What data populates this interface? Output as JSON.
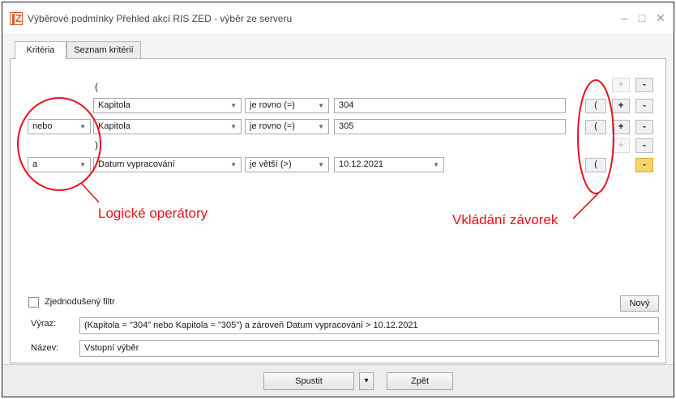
{
  "window": {
    "title": "Výběrové podmínky Přehled akcí RIS ZED - výběr ze serveru",
    "minimize_glyph": "–",
    "maximize_glyph": "□",
    "close_glyph": "✕",
    "icon": "app-logo-icon"
  },
  "tabs": [
    {
      "label": "Kritéria",
      "active": true
    },
    {
      "label": "Seznam kritérií",
      "active": false
    }
  ],
  "criteria": {
    "open_paren": "(",
    "close_paren": ")",
    "rows": [
      {
        "operator": "",
        "field": "Kapitola",
        "condition": "je rovno (=)",
        "value": "304"
      },
      {
        "operator": "nebo",
        "field": "Kapitola",
        "condition": "je rovno (=)",
        "value": "305"
      },
      {
        "operator": "a",
        "field": "Datum vypracování",
        "condition": "je větší (>)",
        "value": "10.12.2021"
      }
    ],
    "paren_button_label": "(",
    "plus_label": "+",
    "minus_label": "-"
  },
  "annotations": {
    "logical_operators": "Logické operátory",
    "bracket_insert": "Vkládání závorek",
    "color": "#e8101a"
  },
  "simplified_filter": {
    "label": "Zjednodušený filtr",
    "checked": false
  },
  "new_button": "Nový",
  "expression": {
    "label": "Výraz:",
    "value": "(Kapitola = \"304\" nebo Kapitola = \"305\") a zároveň Datum vypracování > 10.12.2021"
  },
  "name": {
    "label": "Název:",
    "value": "Vstupní výběr"
  },
  "footer": {
    "run_label": "Spustit",
    "back_label": "Zpět",
    "dropdown_glyph": "▾"
  }
}
